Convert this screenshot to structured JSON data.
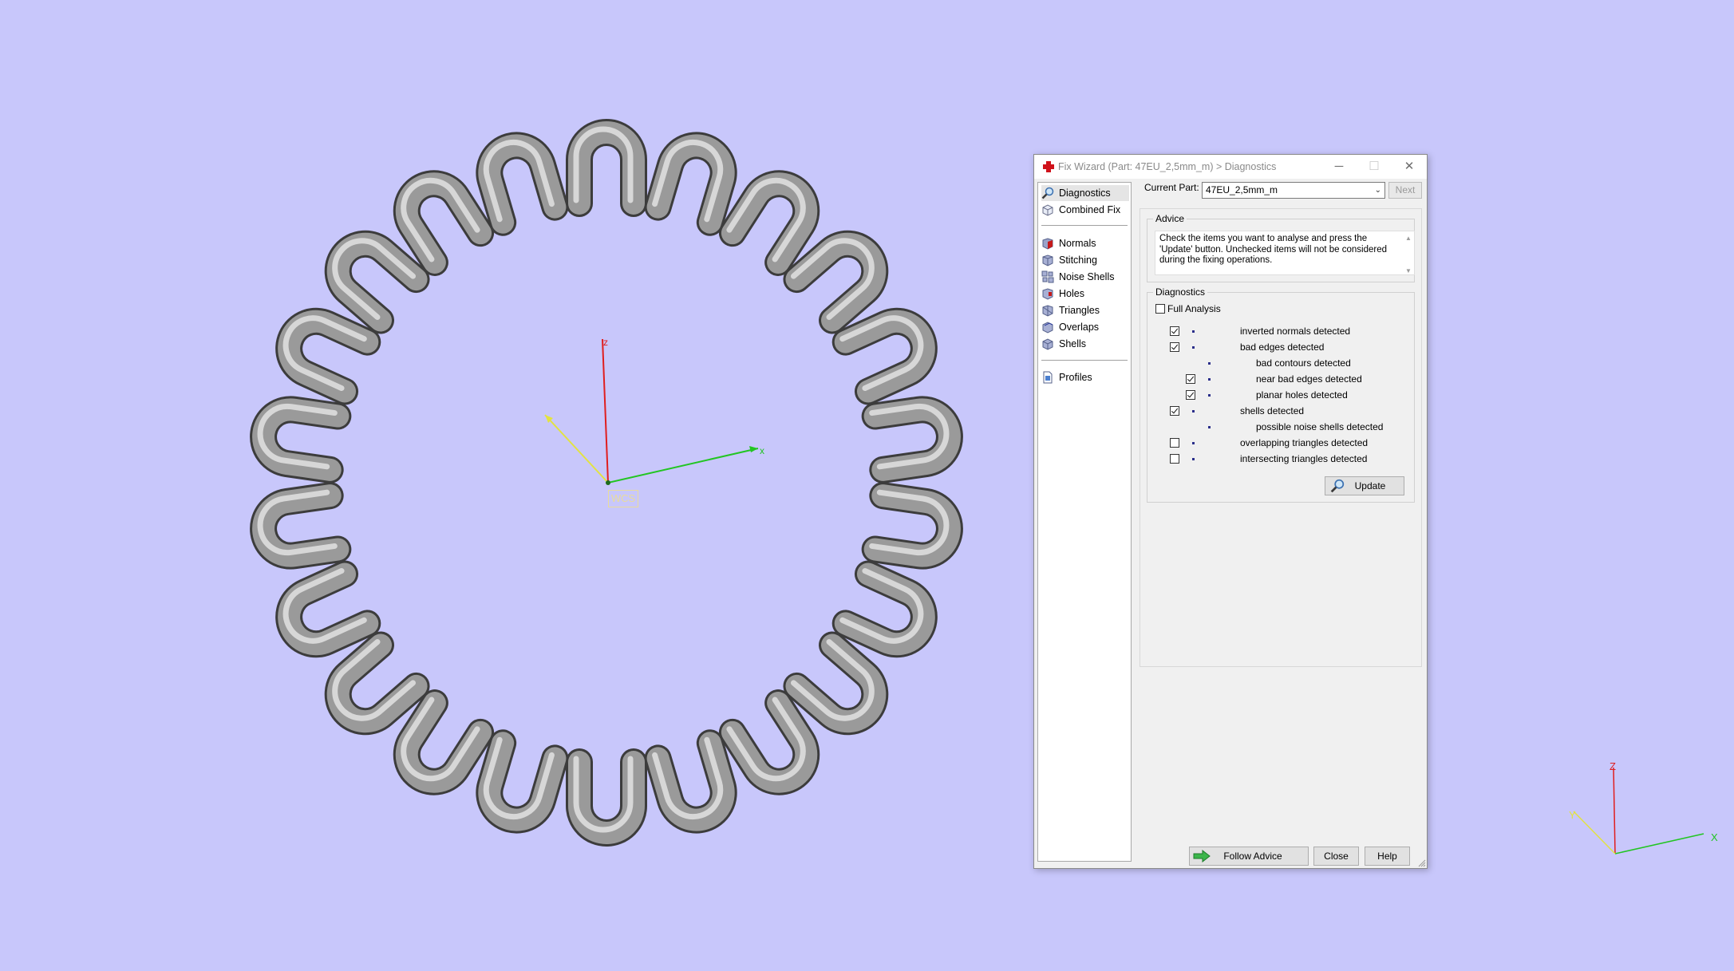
{
  "viewport": {
    "background": "#c8c7fb",
    "wcs_label": "WCS",
    "axis_labels": {
      "x": "x",
      "y": "y",
      "z": "z"
    },
    "mini_axis_labels": {
      "x": "X",
      "y": "Y",
      "z": "Z"
    },
    "axis_colors": {
      "x": "#22c522",
      "y": "#e3e340",
      "z": "#e01e1e"
    }
  },
  "dialog": {
    "title": "Fix Wizard (Part: 47EU_2,5mm_m) > Diagnostics",
    "title_icon": "red-cross-icon",
    "window_controls": {
      "minimize": "─",
      "maximize": "☐",
      "close": "✕"
    },
    "nav": {
      "group1": [
        {
          "label": "Diagnostics",
          "icon": "magnifier-icon",
          "selected": true
        },
        {
          "label": "Combined Fix",
          "icon": "cube-icon"
        }
      ],
      "group2": [
        {
          "label": "Normals",
          "icon": "normals-cube-icon"
        },
        {
          "label": "Stitching",
          "icon": "stitching-cube-icon"
        },
        {
          "label": "Noise Shells",
          "icon": "noise-shells-icon"
        },
        {
          "label": "Holes",
          "icon": "holes-cube-icon"
        },
        {
          "label": "Triangles",
          "icon": "triangles-cube-icon"
        },
        {
          "label": "Overlaps",
          "icon": "overlaps-cube-icon"
        },
        {
          "label": "Shells",
          "icon": "shells-cube-icon"
        }
      ],
      "group3": [
        {
          "label": "Profiles",
          "icon": "profiles-document-icon"
        }
      ]
    },
    "current_part": {
      "label": "Current Part:",
      "value": "47EU_2,5mm_m"
    },
    "next_button": "Next",
    "advice": {
      "title": "Advice",
      "text": "Check the items you want to analyse and press the 'Update' button. Unchecked items will not be considered during the fixing operations."
    },
    "diagnostics": {
      "title": "Diagnostics",
      "full_analysis": {
        "label": "Full Analysis",
        "checked": false
      },
      "items": [
        {
          "label": "inverted normals detected",
          "checked": true,
          "level": 0,
          "has_checkbox": true
        },
        {
          "label": "bad edges detected",
          "checked": true,
          "level": 0,
          "has_checkbox": true
        },
        {
          "label": "bad contours detected",
          "checked": false,
          "level": 1,
          "has_checkbox": false
        },
        {
          "label": "near bad edges detected",
          "checked": true,
          "level": 1,
          "has_checkbox": true
        },
        {
          "label": "planar holes detected",
          "checked": true,
          "level": 1,
          "has_checkbox": true
        },
        {
          "label": "shells detected",
          "checked": true,
          "level": 0,
          "has_checkbox": true
        },
        {
          "label": "possible noise shells detected",
          "checked": false,
          "level": 1,
          "has_checkbox": false
        },
        {
          "label": "overlapping triangles detected",
          "checked": false,
          "level": 0,
          "has_checkbox": true
        },
        {
          "label": "intersecting triangles detected",
          "checked": false,
          "level": 0,
          "has_checkbox": true
        }
      ],
      "update_button": "Update"
    },
    "footer": {
      "follow_advice": "Follow Advice",
      "close": "Close",
      "help": "Help"
    }
  }
}
